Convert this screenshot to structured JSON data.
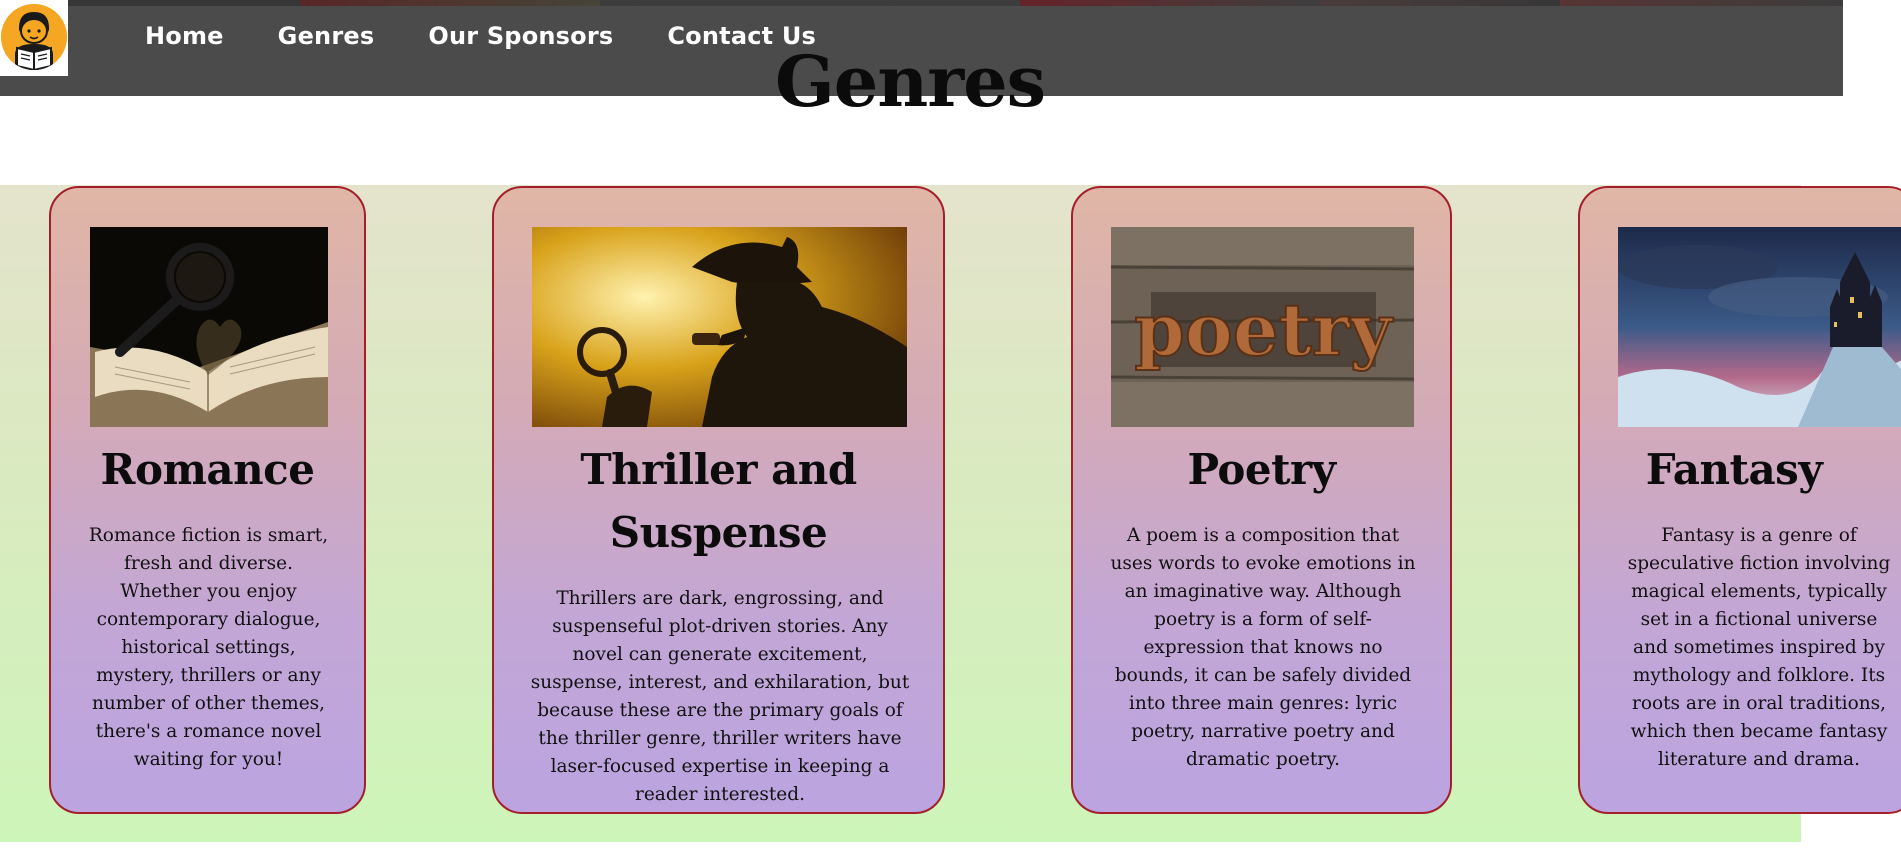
{
  "nav": {
    "links": [
      "Home",
      "Genres",
      "Our Sponsors",
      "Contact Us"
    ]
  },
  "page": {
    "title": "Genres"
  },
  "genres": [
    {
      "title": "Romance",
      "description": "Romance fiction is smart, fresh and diverse. Whether you enjoy contemporary dialogue, historical settings, mystery, thrillers or any number of other themes, there's a romance novel waiting for you!"
    },
    {
      "title": "Thriller and Suspense",
      "description": "Thrillers are dark, engrossing, and suspenseful plot-driven stories. Any novel can generate excitement, suspense, interest, and exhilaration, but because these are the primary goals of the thriller genre, thriller writers have laser-focused expertise in keeping a reader interested."
    },
    {
      "title": "Poetry",
      "description": "A poem is a composition that uses words to evoke emotions in an imaginative way. Although poetry is a form of self-expression that knows no bounds, it can be safely divided into three main genres: lyric poetry, narrative poetry and dramatic poetry.",
      "image_text": "poetry"
    },
    {
      "title": "Fantasy",
      "description": "Fantasy is a genre of speculative fiction involving magical elements, typically set in a fictional universe and sometimes inspired by mythology and folklore. Its roots are in oral traditions, which then became fantasy literature and drama."
    }
  ],
  "colors": {
    "navbar": "#4b4b4b",
    "card_border": "#a3202a",
    "logo_orange": "#f5a623"
  },
  "icons": {
    "logo": "reading-child-icon"
  }
}
